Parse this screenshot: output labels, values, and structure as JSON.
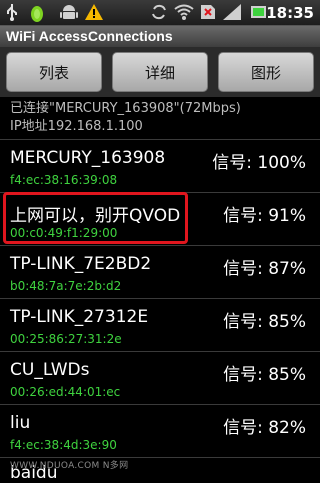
{
  "statusbar": {
    "time": "18:35",
    "icons": [
      "usb-icon",
      "pea-icon",
      "android-icon",
      "warning-icon",
      "sync-icon",
      "wifi-icon",
      "no-sim-icon",
      "signal-icon",
      "battery-icon"
    ]
  },
  "app": {
    "title": "WiFi AccessConnections"
  },
  "toolbar": {
    "list_label": "列表",
    "detail_label": "详细",
    "graph_label": "图形"
  },
  "connection": {
    "status": "已连接\"MERCURY_163908\"(72Mbps)",
    "ip": "IP地址192.168.1.100"
  },
  "networks": [
    {
      "name": "MERCURY_163908",
      "mac": "f4:ec:38:16:39:08",
      "signal": "信号: 100%"
    },
    {
      "name": "上网可以，别开QVOD",
      "mac": "00:c0:49:f1:29:00",
      "signal": "信号: 91%"
    },
    {
      "name": "TP-LINK_7E2BD2",
      "mac": "b0:48:7a:7e:2b:d2",
      "signal": "信号: 87%"
    },
    {
      "name": "TP-LINK_27312E",
      "mac": "00:25:86:27:31:2e",
      "signal": "信号: 85%"
    },
    {
      "name": "CU_LWDs",
      "mac": "00:26:ed:44:01:ec",
      "signal": "信号: 85%"
    },
    {
      "name": "liu",
      "mac": "f4:ec:38:4d:3e:90",
      "signal": "信号: 82%"
    },
    {
      "name": "baidu",
      "mac": "",
      "signal": ""
    }
  ],
  "watermark": "WWW.NDUOA.COM N多网",
  "colors": {
    "mac_text": "#3fd33f",
    "highlight": "#e0161e",
    "background": "#000000"
  }
}
